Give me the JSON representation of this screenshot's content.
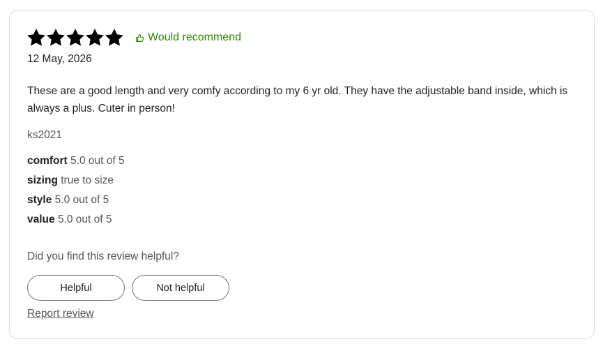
{
  "review": {
    "rating": 5,
    "rating_max": 5,
    "star_color": "#000000",
    "recommend_icon": "thumbs-up-icon",
    "recommend_label": "Would recommend",
    "recommend_color": "#2a8703",
    "date": "12 May, 2026",
    "text": "These are a good length and very comfy according to my 6 yr old. They have the adjustable band inside, which is always a plus. Cuter in person!",
    "author": "ks2021",
    "attributes": [
      {
        "key": "comfort",
        "value": "5.0 out of 5"
      },
      {
        "key": "sizing",
        "value": "true to size"
      },
      {
        "key": "style",
        "value": "5.0 out of 5"
      },
      {
        "key": "value",
        "value": "5.0 out of 5"
      }
    ]
  },
  "feedback": {
    "question": "Did you find this review helpful?",
    "helpful_label": "Helpful",
    "not_helpful_label": "Not helpful",
    "report_label": "Report review"
  }
}
